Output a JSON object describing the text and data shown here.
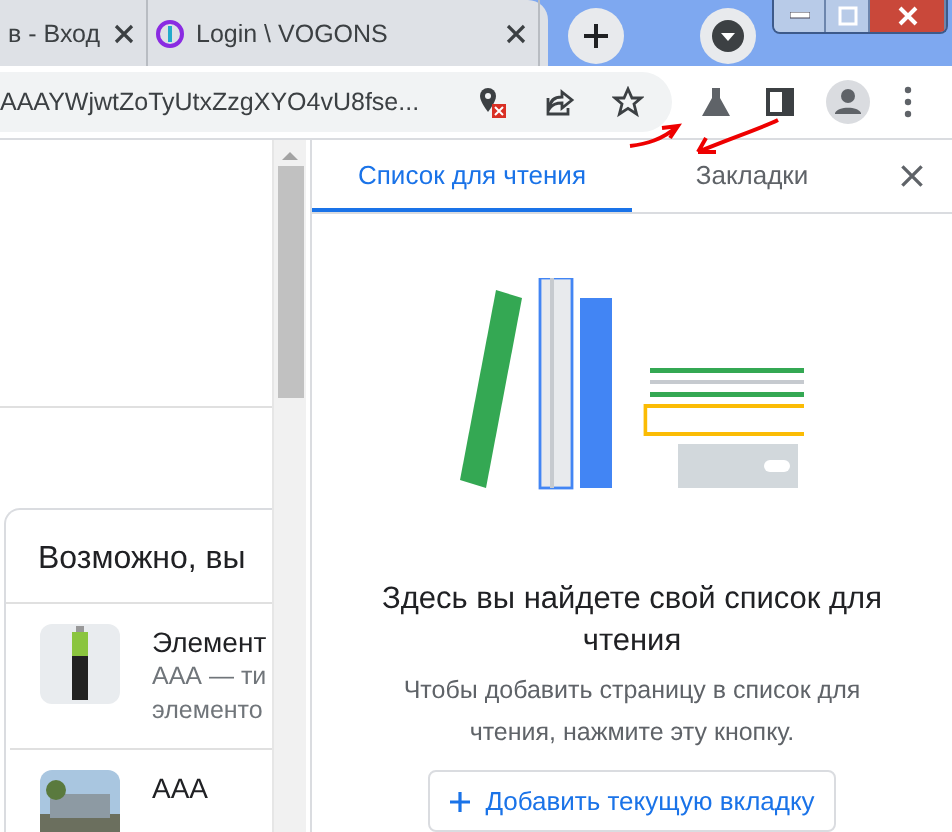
{
  "browser_tabs": [
    {
      "title": "в - Вход"
    },
    {
      "title": "Login \\ VOGONS"
    }
  ],
  "address_bar": {
    "value": "AAAYWjwtZoTyUtxZzgXYO4vU8fse..."
  },
  "page": {
    "card_title": "Возможно, вы",
    "items": [
      {
        "title": "Элемент",
        "description": [
          "ААА — ти",
          "элементо"
        ]
      },
      {
        "title": "ААА"
      }
    ]
  },
  "side_panel": {
    "tabs": [
      {
        "label": "Список для чтения",
        "selected": true
      },
      {
        "label": "Закладки",
        "selected": false
      }
    ],
    "heading": "Здесь вы найдете свой список для чтения",
    "text": "Чтобы добавить страницу в список для чтения, нажмите эту кнопку.",
    "button": "Добавить текущую вкладку"
  }
}
